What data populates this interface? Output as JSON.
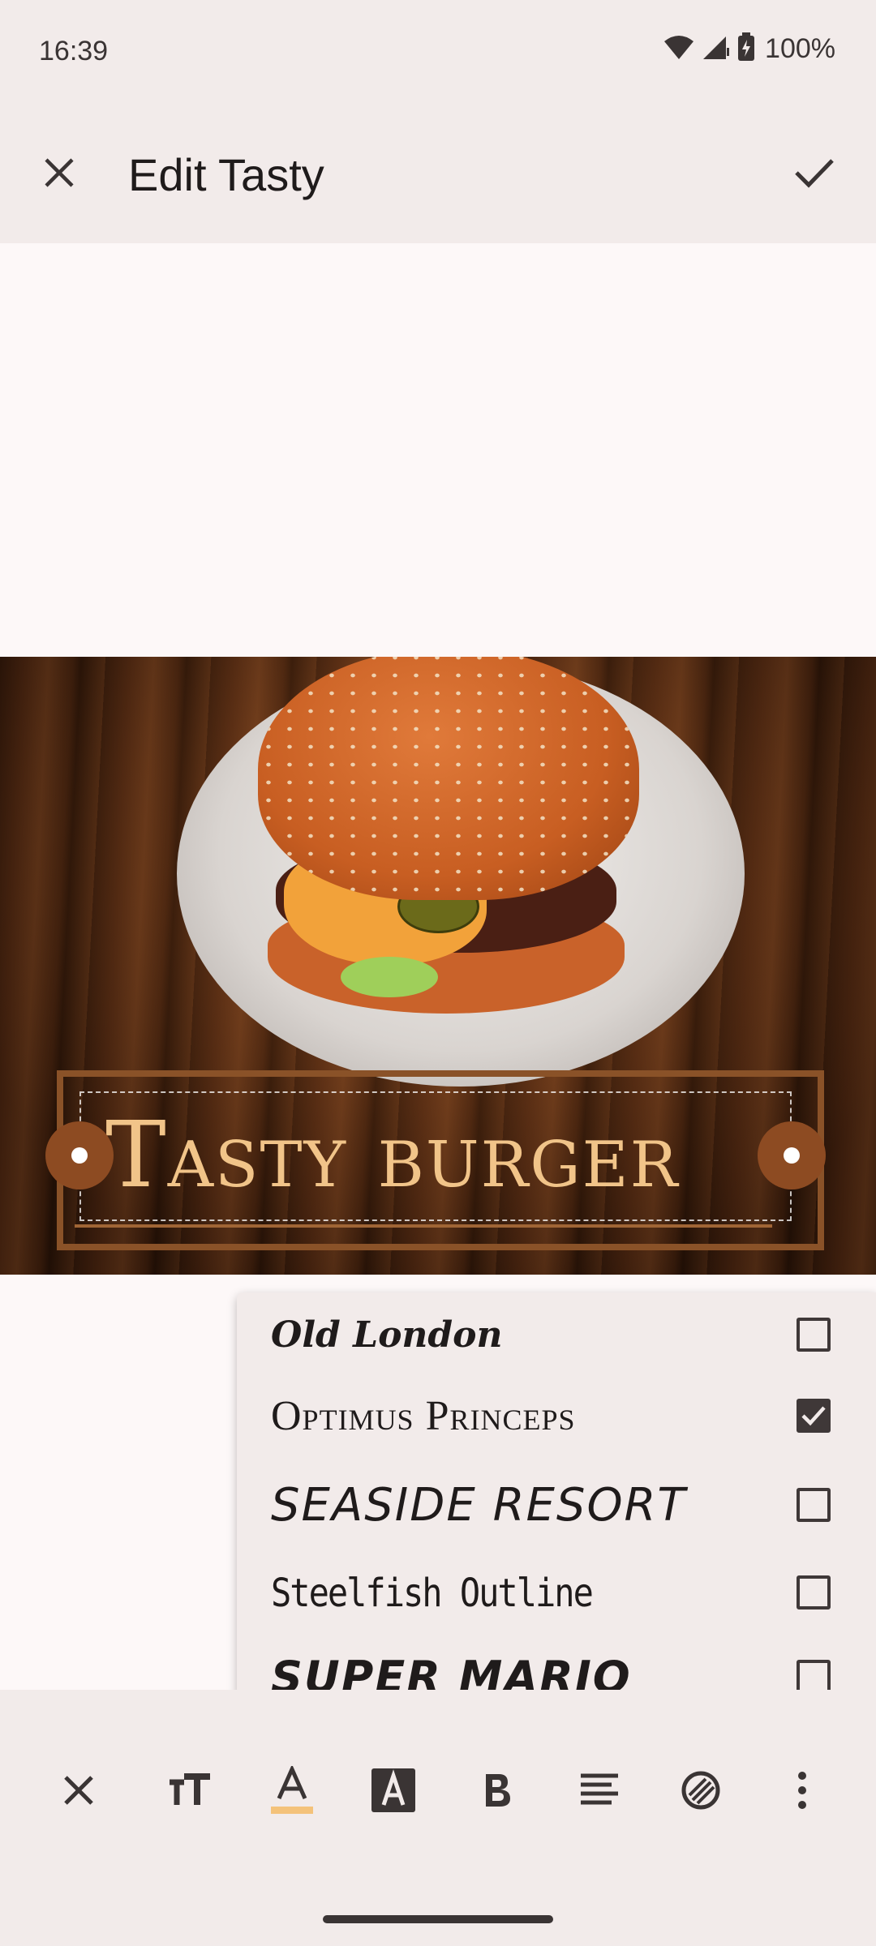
{
  "status_bar": {
    "time": "16:39",
    "battery": "100%"
  },
  "app_bar": {
    "title": "Edit Tasty"
  },
  "canvas": {
    "overlay_text": "Tasty burger"
  },
  "font_menu": {
    "items": [
      {
        "label": "Old London",
        "checked": false
      },
      {
        "label": "Optimus Princeps",
        "checked": true
      },
      {
        "label": "SEASIDE RESORT",
        "checked": false
      },
      {
        "label": "Steelfish Outline",
        "checked": false
      },
      {
        "label": "SUPER MARIO",
        "checked": false
      }
    ]
  },
  "toolbar": {
    "tools": [
      "close-icon",
      "text-size-icon",
      "text-color-icon",
      "text-background-icon",
      "bold-icon",
      "align-icon",
      "texture-icon",
      "more-vert-icon"
    ],
    "text_color_accent": "#f4c27a"
  },
  "colors": {
    "frame": "#8a5228",
    "text": "#f1c489",
    "handle": "#8d4b22"
  }
}
